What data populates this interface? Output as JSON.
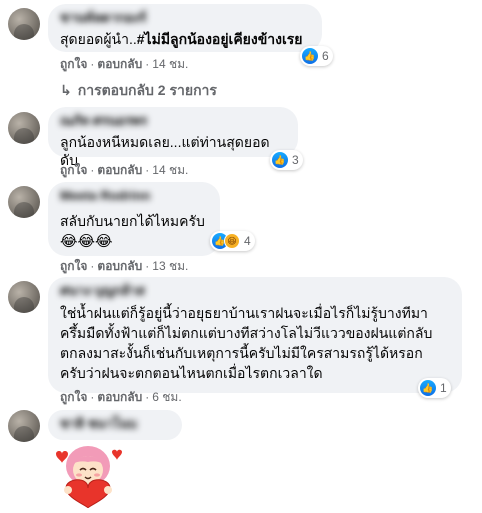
{
  "colors": {
    "bubble_bg": "#f0f2f5",
    "meta_text": "#65676b",
    "like_blue": "#1877f2",
    "haha_yellow": "#f7b125",
    "heart_red": "#e8342b"
  },
  "actions": {
    "like": "ถูกใจ",
    "reply": "ตอบกลับ",
    "separator": "·"
  },
  "comments": [
    {
      "author": "ชานท์ลดากองร์",
      "text_prefix": "สุดยอดผู้นำ..",
      "text_hashtag": "#ไม่มีลูกน้องอยู่เคียงข้างเรย",
      "reactions": {
        "types": [
          "like-icon"
        ],
        "count": "6"
      },
      "time": "14 ชม."
    },
    {
      "author": "ณภัท ศรนอรพร",
      "text": "ลูกน้องหนีหมดเลย...แต่ท่านสุดยอดดับ",
      "reactions": {
        "types": [
          "like-icon"
        ],
        "count": "3"
      },
      "time": "14 ชม."
    },
    {
      "author": "Meeta Rodrinn",
      "text": "สลับกับนายกได้ไหมครับ",
      "emoji": "😂😂😂",
      "reactions": {
        "types": [
          "like-icon",
          "haha-icon"
        ],
        "count": "4"
      },
      "time": "13 ชม."
    },
    {
      "author": "ศนาง บุญกล้าส",
      "lines": [
        "ใช่น้ำฝนแต่ก็รู้อยู่นี้ว่าอยุธยาบ้านเราฝนจะเมื่อไรก็ไม่รู้บางทีมา",
        "ครึ้มมืดทั้งฟ้าแต่ก็ไม่ตกแต่บางทีสว่างโลไม่วีแววของฝนแต่กลับ",
        "ตกลงมาสะงั้นก็เช่นกับเหตุการนี้ครับไม่มีใครสามรถรู้ได้หรอก",
        "ครับว่าฝนจะตกตอนไหนตกเมื่อไรตกเวลาใด"
      ],
      "reactions": {
        "types": [
          "like-icon"
        ],
        "count": "1"
      },
      "time": "6 ชม."
    },
    {
      "author": "ชาลิ ชนาโนบ"
    }
  ],
  "replies_link": {
    "arrow": "↳",
    "text": "การตอบกลับ 2 รายการ"
  }
}
